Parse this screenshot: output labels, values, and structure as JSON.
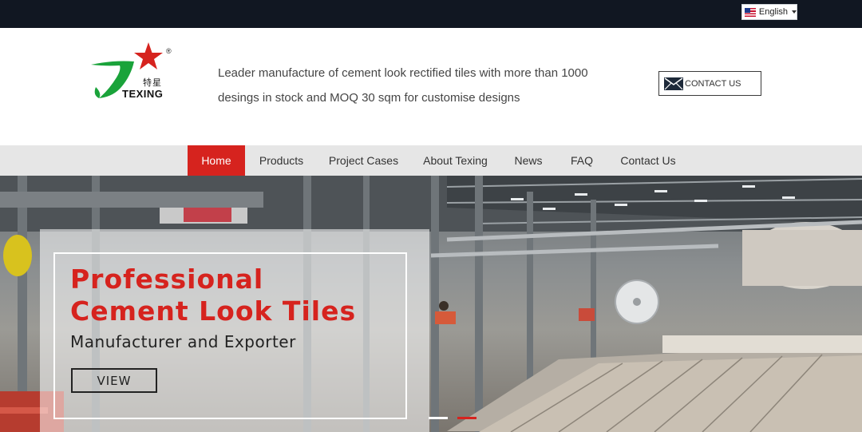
{
  "topbar": {
    "language": "English",
    "flag_icon": "us-flag-icon"
  },
  "header": {
    "logo": {
      "brand_en": "TEXING",
      "brand_cn": "特星",
      "registered": "®"
    },
    "tagline_line1": "Leader manufacture of cement look rectified tiles with more than 1000",
    "tagline_line2": "desings in stock and MOQ 30 sqm for customise designs",
    "contact_label": "CONTACT US"
  },
  "nav": {
    "items": [
      {
        "label": "Home",
        "active": true
      },
      {
        "label": "Products"
      },
      {
        "label": "Project Cases"
      },
      {
        "label": "About Texing"
      },
      {
        "label": "News"
      },
      {
        "label": "FAQ"
      },
      {
        "label": "Contact Us"
      }
    ]
  },
  "hero": {
    "title_line1": "Professional",
    "title_line2": "Cement Look Tiles",
    "subtitle": "Manufacturer and Exporter",
    "view_label": "VIEW",
    "slides": 2,
    "active_slide": 2
  },
  "colors": {
    "topbar": "#111722",
    "accent_red": "#d6231e",
    "nav_bg": "#e6e6e6",
    "logo_green": "#1aa33a"
  }
}
